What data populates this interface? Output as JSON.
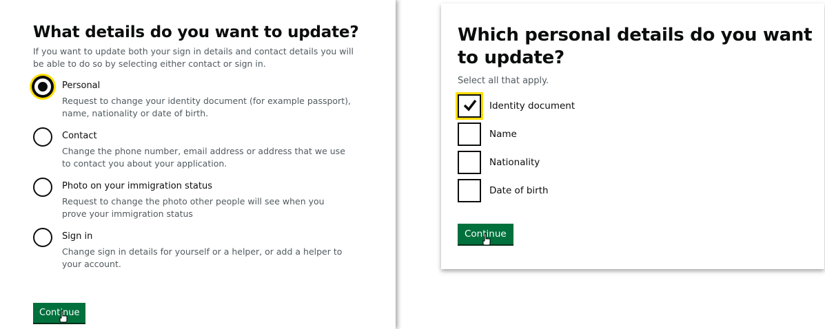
{
  "left": {
    "title": "What details do you want to update?",
    "hint": "If you want to update both your sign in details and contact details you will be able to do so by selecting either contact or sign in.",
    "options": [
      {
        "label": "Personal",
        "hint": "Request to change your identity document (for example passport), name, nationality or date of birth.",
        "checked": true
      },
      {
        "label": "Contact",
        "hint": "Change the phone number, email address or address that we use to contact you about your application.",
        "checked": false
      },
      {
        "label": "Photo on your immigration status",
        "hint": "Request to change the photo other people will see when you prove your immigration status",
        "checked": false
      },
      {
        "label": "Sign in",
        "hint": "Change sign in details for yourself or a helper, or add a helper to your account.",
        "checked": false
      }
    ],
    "continue_label": "Continue"
  },
  "right": {
    "title": "Which personal details do you want to update?",
    "hint": "Select all that apply.",
    "options": [
      {
        "label": "Identity document",
        "checked": true
      },
      {
        "label": "Name",
        "checked": false
      },
      {
        "label": "Nationality",
        "checked": false
      },
      {
        "label": "Date of birth",
        "checked": false
      }
    ],
    "continue_label": "Continue"
  },
  "colors": {
    "button_green": "#00703c",
    "focus_yellow": "#ffdd00",
    "text": "#0b0c0c",
    "hint_text": "#505a5f"
  },
  "icons": [
    "check-icon",
    "mouse-cursor-icon"
  ]
}
